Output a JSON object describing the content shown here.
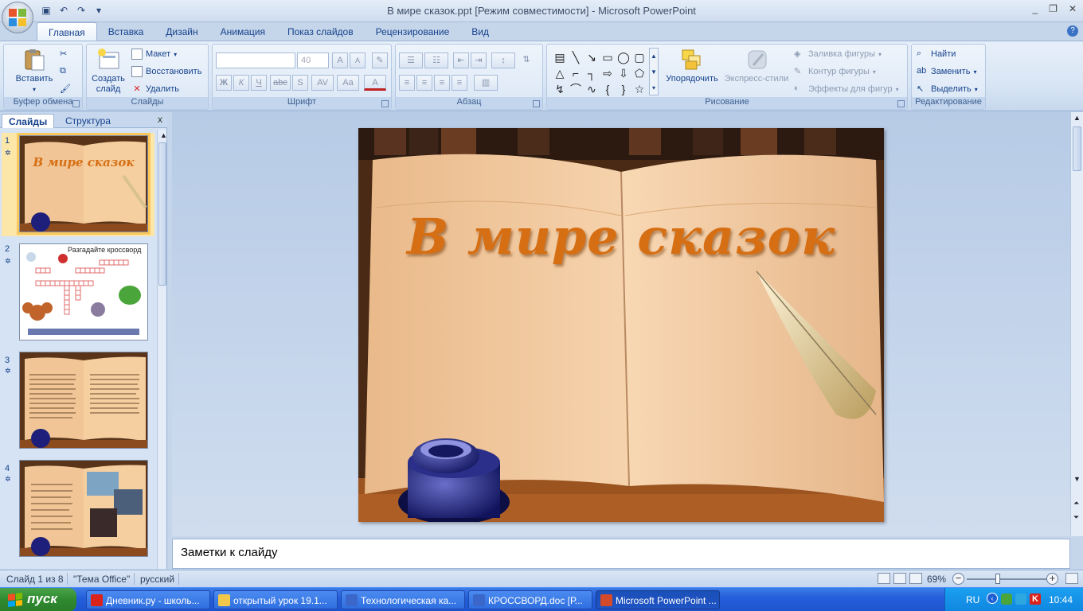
{
  "window": {
    "title": "В мире сказок.ppt [Режим совместимости] - Microsoft PowerPoint",
    "controls": [
      "_",
      "❐",
      "✕"
    ]
  },
  "ribbon": {
    "tabs": [
      "Главная",
      "Вставка",
      "Дизайн",
      "Анимация",
      "Показ слайдов",
      "Рецензирование",
      "Вид"
    ],
    "active_tab": "Главная",
    "clipboard": {
      "paste": "Вставить",
      "label": "Буфер обмена"
    },
    "slides": {
      "new_slide_line1": "Создать",
      "new_slide_line2": "слайд",
      "layout": "Макет",
      "reset": "Восстановить",
      "delete": "Удалить",
      "label": "Слайды"
    },
    "font": {
      "size_value": "40",
      "label": "Шрифт",
      "buttons": [
        "Ж",
        "К",
        "Ч",
        "abc",
        "S",
        "AV",
        "Aa",
        "A"
      ],
      "grow": "A",
      "shrink": "A"
    },
    "paragraph": {
      "label": "Абзац"
    },
    "drawing": {
      "arrange": "Упорядочить",
      "quick_styles": "Экспресс-стили",
      "fill": "Заливка фигуры",
      "outline": "Контур фигуры",
      "effects": "Эффекты для фигур",
      "label": "Рисование"
    },
    "editing": {
      "find": "Найти",
      "replace": "Заменить",
      "select": "Выделить",
      "label": "Редактирование"
    }
  },
  "left_pane": {
    "tabs": [
      "Слайды",
      "Структура"
    ],
    "close": "x",
    "slides": [
      {
        "number": "1",
        "title": "В мире сказок"
      },
      {
        "number": "2",
        "title": "Разгадайте кроссворд"
      },
      {
        "number": "3",
        "title": ""
      },
      {
        "number": "4",
        "title": ""
      }
    ]
  },
  "slide": {
    "title": "В мире сказок"
  },
  "notes": {
    "placeholder": "Заметки к слайду"
  },
  "status": {
    "slide_info": "Слайд 1 из 8",
    "theme": "\"Тема Office\"",
    "language": "русский",
    "zoom": "69%",
    "zoom_fraction": 0.39
  },
  "taskbar": {
    "start": "пуск",
    "tasks": [
      {
        "label": "Дневник.ру - школь...",
        "color": "#d9241c"
      },
      {
        "label": "открытый урок 19.1...",
        "color": "#f1c84a"
      },
      {
        "label": "Технологическая ка...",
        "color": "#3a67c9"
      },
      {
        "label": "КРОССВОРД.doc [Р...",
        "color": "#3a67c9"
      },
      {
        "label": "Microsoft PowerPoint ...",
        "color": "#d24a2a"
      }
    ],
    "active_task": 4,
    "lang": "RU",
    "clock": "10:44"
  },
  "colors": {
    "title_orange": "#d66f14",
    "ribbon_blue": "#15428b",
    "taskbar_blue": "#245edb",
    "start_green": "#2f8a2f"
  }
}
